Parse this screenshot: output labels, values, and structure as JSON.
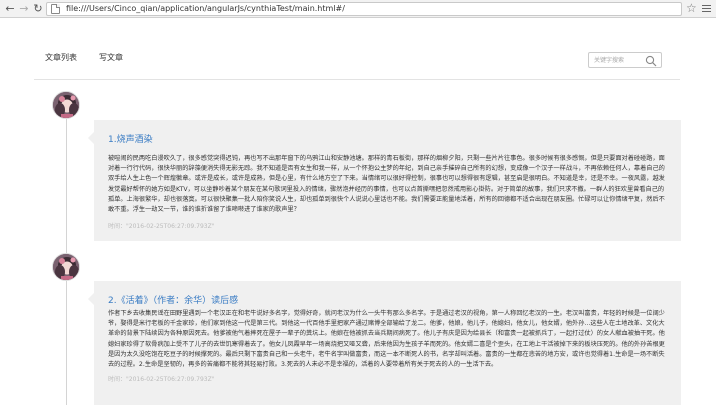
{
  "browser": {
    "url": "file:///Users/Cinco_qian/application/angularJs/cynthiaTest/main.html#/",
    "back_icon": "back-arrow-icon",
    "forward_icon": "forward-arrow-icon",
    "reload_icon": "reload-icon",
    "page_icon": "document-icon",
    "bookmark_icon": "star-icon",
    "menu_icon": "hamburger-menu-icon"
  },
  "header": {
    "nav": [
      {
        "label": "文章列表"
      },
      {
        "label": "写文章"
      }
    ],
    "search": {
      "placeholder": "关键字搜索",
      "icon": "search-icon"
    }
  },
  "colors": {
    "title": "#3a7cc4",
    "card_bg": "#f0f0f0",
    "timeline": "#d4d4d4"
  },
  "articles": [
    {
      "title": "1.烧声酒染",
      "body": "被喧闹的民两吃白漫吹久了，很多感觉突得迟钝，再也写不出那年窗下的乌鸦江山和安静池塘。那样的青石板街，那样的烟柳夕阳，只剩一些片片往事色。很多时候有很多感慨，但是只要面对着碰碰路，面对着一行行代码，很快华丽的辞藻便消失得无影无踪。我不知道是否有女生和我一样，从一个怀抱公主梦的年纪，到自己亲手摧碎自己所有的幻想，变成像一个汉子一样战斗，不再依赖任何人，靠着自己的双手给人生上色一个辉煌徽章。或许是成长，或许是成熟，但是心里，有什么地方空了下来。当情绪可以很好得控制，很事也可以想得很有逻辑，甚至启是很明白。不知道是幸，还是不幸。一夜风露，越发发觉最好帮怀的她方如是KTV，可以坐静吵着某个朋友在某句歌词里投入的情绪，骤然泡并经历的事情，也可以点首撕嘿把忽然戒用影心掛防。对于简单的故事，我们只求不撒。一群人的狂欢里曾看自己的孤单。上海很繁华，却也很落寞。可以很快聚集一批人陪你笑说人生，却也孤单到很快个人说说心里话也不能。我们需要正能量地活着，所有的回德都不适合出现在朋友圈。忙碌可以让你情绪平复，然后不敢不重。浮生一劫又一节，谁的谁折谁留了谁啼啭进了谁家的歌声里？",
      "time": "时间：\"2016-02-25T06:27:09.793Z\""
    },
    {
      "title": "2.《活着》（作者：余华）读后感",
      "body": "作者下乡去收集民谣在田野里遇到一个老汉正在和老牛说好多名字，觉得好奇，就问老汉为什么一头牛有那么多名字。于是通过老汉的视角，第一人称回忆老汉的一生。老汉叫富贵，年轻的时候是一位阔少爷，娶得是米行老板的千金家珍，他们家到他这一代是第三代。到他这一代百他手里把家产通过赌博全部输给了龙二。他爹，他娘，他儿子，他媳妇，他女儿，他女婿，他外孙...这些人在土地改革、文化大革命的背景下陆续因为各种原因死去。他爹被他气着摔死在屋子一辈子的粪坑上。他娘在他被抓去当兵期间病死了。他儿子有庆是因为给县长（和富贵一起被抓兵丁，一起打过仗）的女人献血被抽干死。他媳妇家珍得了软骨病加上受不了儿子的去世饥寒得着去了。他女儿凤霞早年一场高烧把又哑又聋，后来他因为生孩子羊而死的。他女婿二喜是个歪头，在工地上干活被掉下来的板块压死的。他的外孙苦根更是因为太久没吃饱在吃豆子的时候撑死的。最后只剩下富贵自己和一头老牛，老牛名字叫做富贵，而这一本不断死人的书，名字却叫活着。富贵的一生都在悲苦的地方安，或许也觉得着1.生命是一场不断失去的过程。2.生命是坚韧的，再多的苦痛都不能将其轻易打败。3.死去的人未必不是幸福的，活着的人要带着所有关于死去的人的一生活下去。",
      "time": "时间：\"2016-02-25T06:27:09.793Z\""
    }
  ]
}
